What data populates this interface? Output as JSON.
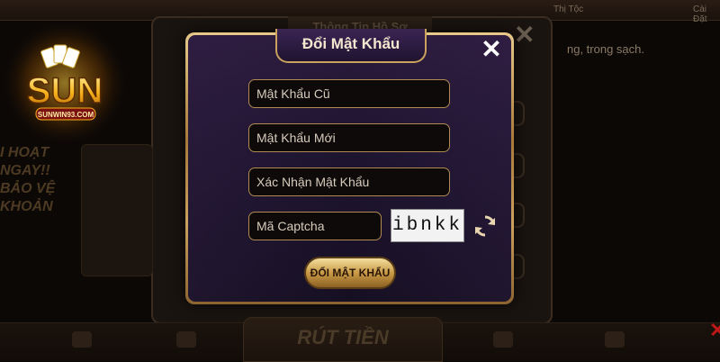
{
  "background": {
    "topbar_items": [
      "Thị Tộc",
      "Cài Đặt"
    ],
    "panel_title": "Thông Tin Hồ Sơ",
    "notice_text": "ng, trong sạch.",
    "side_promo_lines": [
      "I HOẠT",
      "NGAY!!",
      "BẢO VỆ",
      "KHOẢN"
    ],
    "bottom_center_label": "RÚT TIỀN"
  },
  "logo": {
    "brand": "SUN",
    "sub": "SUNWIN93.COM",
    "icon": "playing-cards-icon"
  },
  "modal": {
    "title": "Đổi Mật Khẩu",
    "close_icon": "close-icon",
    "fields": {
      "old_password_placeholder": "Mật Khẩu Cũ",
      "new_password_placeholder": "Mật Khẩu Mới",
      "confirm_password_placeholder": "Xác Nhận Mật Khẩu",
      "captcha_placeholder": "Mã Captcha"
    },
    "captcha_text": "ibnkk",
    "refresh_icon": "refresh-icon",
    "submit_label": "ĐỔI MẬT KHẨU"
  },
  "colors": {
    "accent_gold": "#caa15d",
    "modal_purple": "#2b1a3c",
    "button_gold": "#c99a46"
  }
}
